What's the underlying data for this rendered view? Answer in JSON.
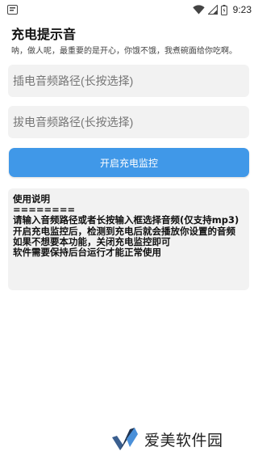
{
  "status_bar": {
    "time": "9:23",
    "icons": [
      "app-notification-icon",
      "wifi-icon",
      "signal-icon",
      "battery-icon"
    ]
  },
  "header": {
    "title": "充电提示音",
    "subtitle": "呐，做人呢，最重要的是开心，你饿不饿，我煮碗面给你吃啊。"
  },
  "inputs": {
    "plug_placeholder": "插电音频路径(长按选择)",
    "unplug_placeholder": "拔电音频路径(长按选择)"
  },
  "actions": {
    "start_label": "开启充电监控"
  },
  "instructions": {
    "heading": "使用说明",
    "divider": "========",
    "lines": [
      "请输入音频路径或者长按输入框选择音频(仅支持mp3)",
      "开启充电监控后，检测到充电后就会播放你设置的音频",
      "如果不想要本功能，关闭充电监控即可",
      "软件需要保持后台运行才能正常使用"
    ]
  },
  "watermark": {
    "text": "爱美软件园"
  },
  "colors": {
    "accent": "#4098e8",
    "field_bg": "#f2f2f2",
    "placeholder": "#9a9a9a"
  }
}
